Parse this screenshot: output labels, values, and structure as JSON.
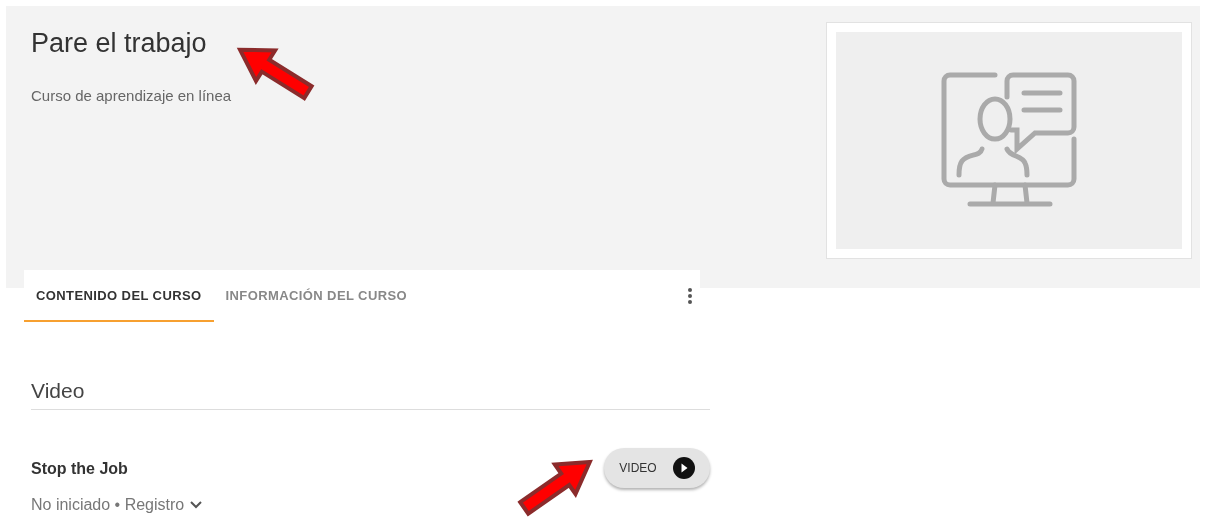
{
  "header": {
    "title": "Pare el trabajo",
    "subtitle": "Curso de aprendizaje en línea"
  },
  "tabs": [
    {
      "label": "CONTENIDO DEL CURSO",
      "selected": true
    },
    {
      "label": "INFORMACIÓN DEL CURSO",
      "selected": false
    }
  ],
  "sections": [
    {
      "title": "Video",
      "items": [
        {
          "title": "Stop the Job",
          "status": "No iniciado • Registro",
          "button": "VIDEO"
        }
      ]
    }
  ]
}
